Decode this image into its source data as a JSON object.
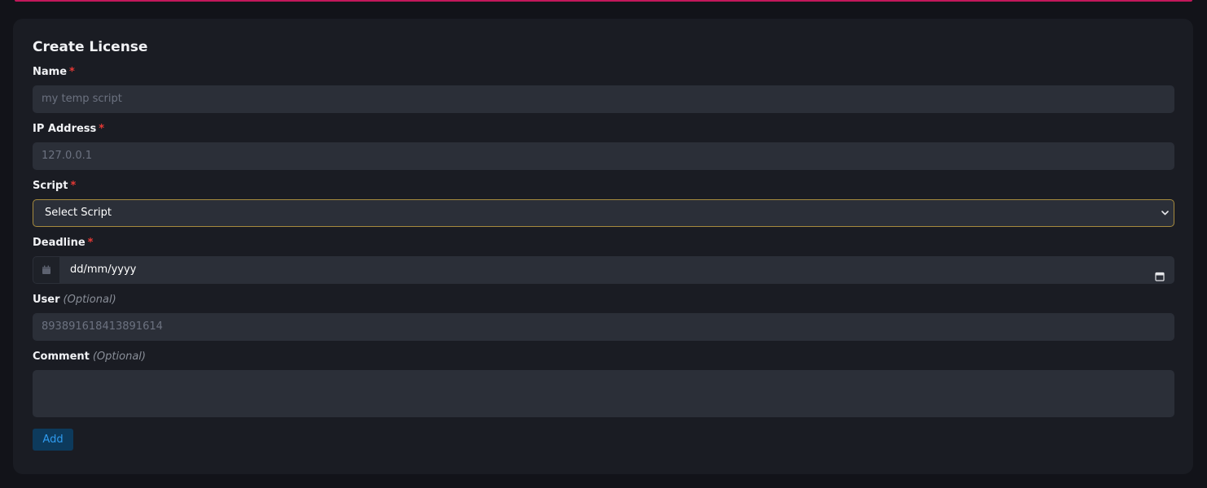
{
  "form": {
    "title": "Create License",
    "required_mark": "*",
    "name": {
      "label": "Name",
      "placeholder": "my temp script"
    },
    "ip": {
      "label": "IP Address",
      "placeholder": "127.0.0.1"
    },
    "script": {
      "label": "Script",
      "selected": "Select Script"
    },
    "deadline": {
      "label": "Deadline",
      "value": "dd/mm/yyyy"
    },
    "user": {
      "label": "User",
      "optional": "(Optional)",
      "placeholder": "893891618413891614"
    },
    "comment": {
      "label": "Comment",
      "optional": "(Optional)"
    },
    "submit_label": "Add"
  },
  "colors": {
    "accent_top": "#c2185b",
    "required": "#e53935",
    "select_focus_border": "#a68a3e",
    "button_bg": "#0d3a5c",
    "button_text": "#2f9bef"
  },
  "icons": {
    "deadline_prefix": "calendar-icon",
    "date_picker": "calendar-icon",
    "select_arrow": "chevron-down-icon"
  }
}
